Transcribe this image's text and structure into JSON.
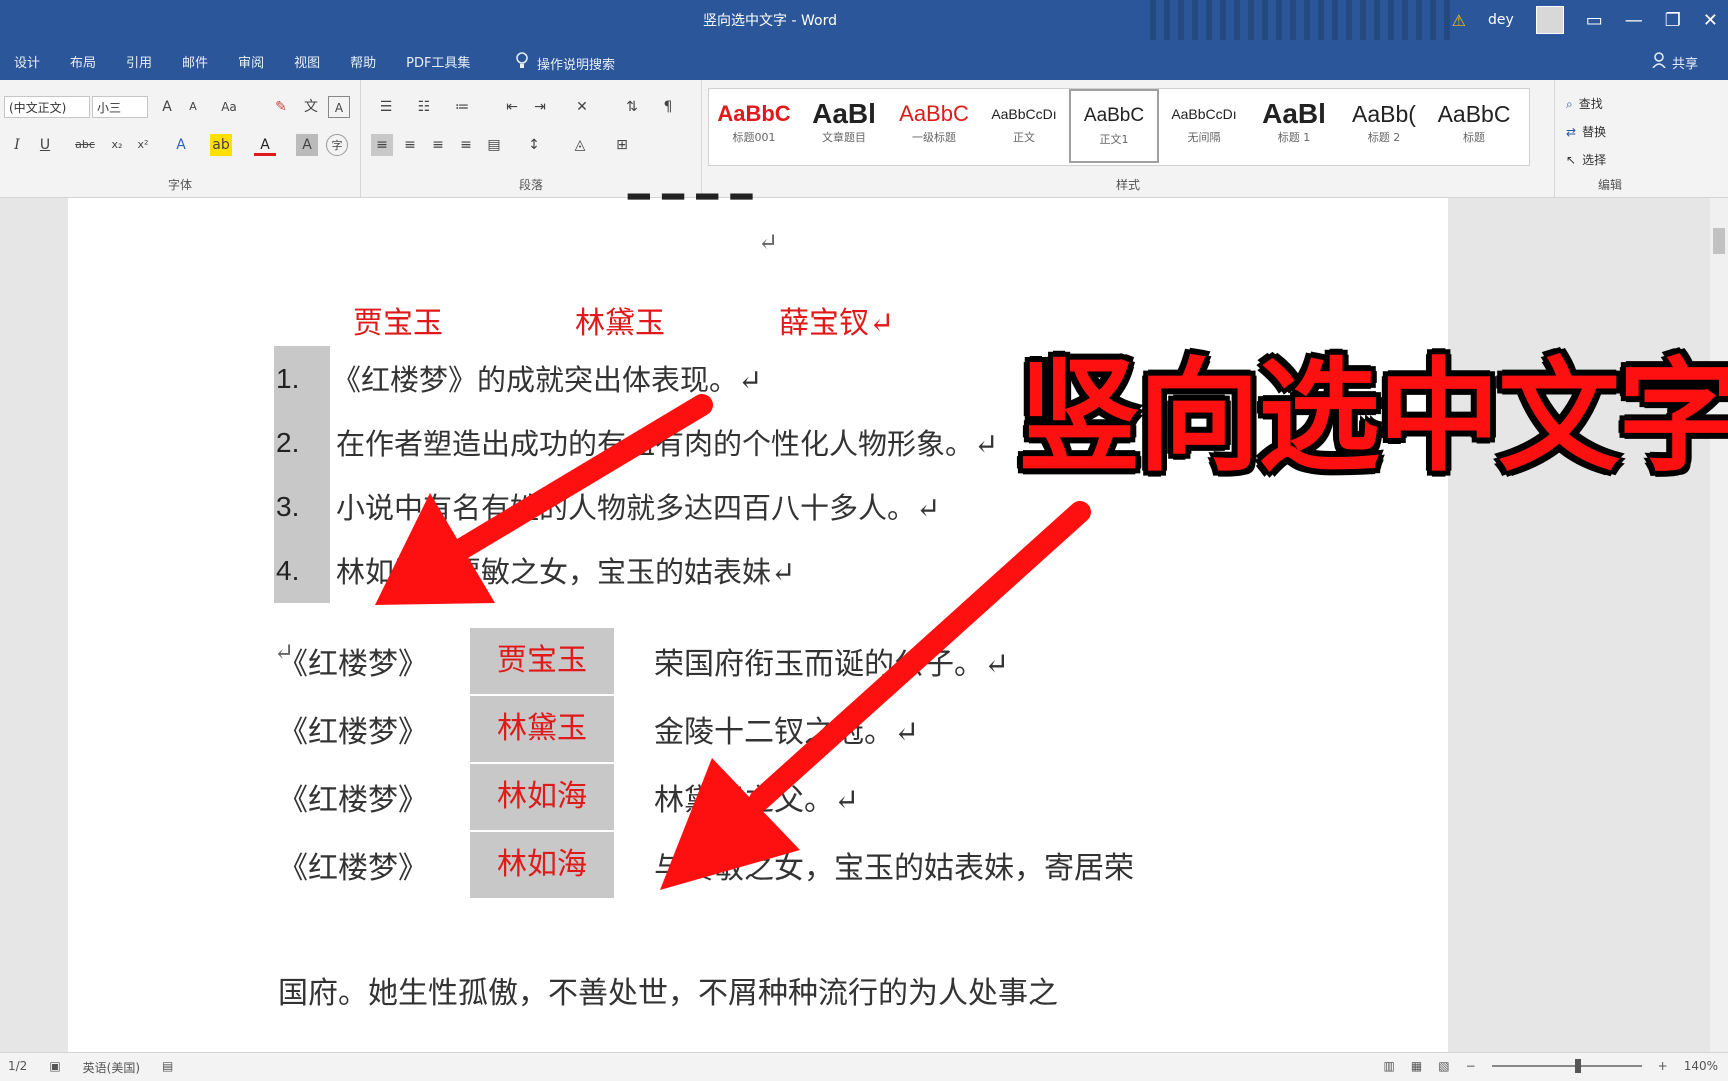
{
  "window": {
    "title": "竖向选中文字 - Word",
    "user": "dey",
    "controls": [
      "⚠",
      "▭",
      "—",
      "❐",
      "✕"
    ]
  },
  "tabs": [
    "设计",
    "布局",
    "引用",
    "邮件",
    "审阅",
    "视图",
    "帮助",
    "PDF工具集"
  ],
  "tell_me": "操作说明搜索",
  "share": "共享",
  "ribbon": {
    "font_name": "(中文正文)",
    "font_size": "小三",
    "groups": {
      "font": "字体",
      "paragraph": "段落",
      "styles": "样式",
      "editing": "编辑"
    },
    "styles": [
      {
        "sample": "AaBbC",
        "name": "标题001",
        "color": "#e01a1a"
      },
      {
        "sample": "AaBl",
        "name": "文章题目",
        "color": "#222222"
      },
      {
        "sample": "AaBbC",
        "name": "一级标题",
        "color": "#e01a1a"
      },
      {
        "sample": "AaBbCcDı",
        "name": "正文",
        "color": "#222222"
      },
      {
        "sample": "AaBbC",
        "name": "正文1",
        "color": "#222222"
      },
      {
        "sample": "AaBbCcDı",
        "name": "无间隔",
        "color": "#222222"
      },
      {
        "sample": "AaBl",
        "name": "标题 1",
        "color": "#222222"
      },
      {
        "sample": "AaBb(",
        "name": "标题 2",
        "color": "#222222"
      },
      {
        "sample": "AaBbC",
        "name": "标题",
        "color": "#222222"
      }
    ],
    "editing": [
      "查找",
      "替换",
      "选择"
    ]
  },
  "document": {
    "paragraph_mark": "↵",
    "names": [
      "贾宝玉",
      "林黛玉",
      "薛宝钗↵"
    ],
    "list": [
      {
        "num": "1.",
        "text": "《红楼梦》的成就突出体表现。↵"
      },
      {
        "num": "2.",
        "text": "在作者塑造出成功的有血有肉的个性化人物形象。↵"
      },
      {
        "num": "3.",
        "text": "小说中有名有姓的人物就多达四百八十多人。↵"
      },
      {
        "num": "4.",
        "text": "林如海与贾敏之女，宝玉的姑表妹↵"
      }
    ],
    "rows": [
      {
        "book": "《红楼梦》",
        "person": "贾宝玉",
        "desc": "荣国府衔玉而诞的公子。↵"
      },
      {
        "book": "《红楼梦》",
        "person": "林黛玉",
        "desc": "金陵十二钗之冠。↵"
      },
      {
        "book": "《红楼梦》",
        "person": "林如海",
        "desc": "林黛玉之父。↵"
      },
      {
        "book": "《红楼梦》",
        "person": "林如海",
        "desc": "与贾敏之女，宝玉的姑表妹，寄居荣"
      }
    ],
    "continuation": "国府。她生性孤傲，不善处世，不屑种种流行的为人处事之"
  },
  "status": {
    "page": "1/2",
    "language": "英语(美国)",
    "zoom": "140%",
    "zoom_fraction": 0.58
  },
  "overlay": {
    "title": "竖向选中文字",
    "color": "#ff1010"
  }
}
